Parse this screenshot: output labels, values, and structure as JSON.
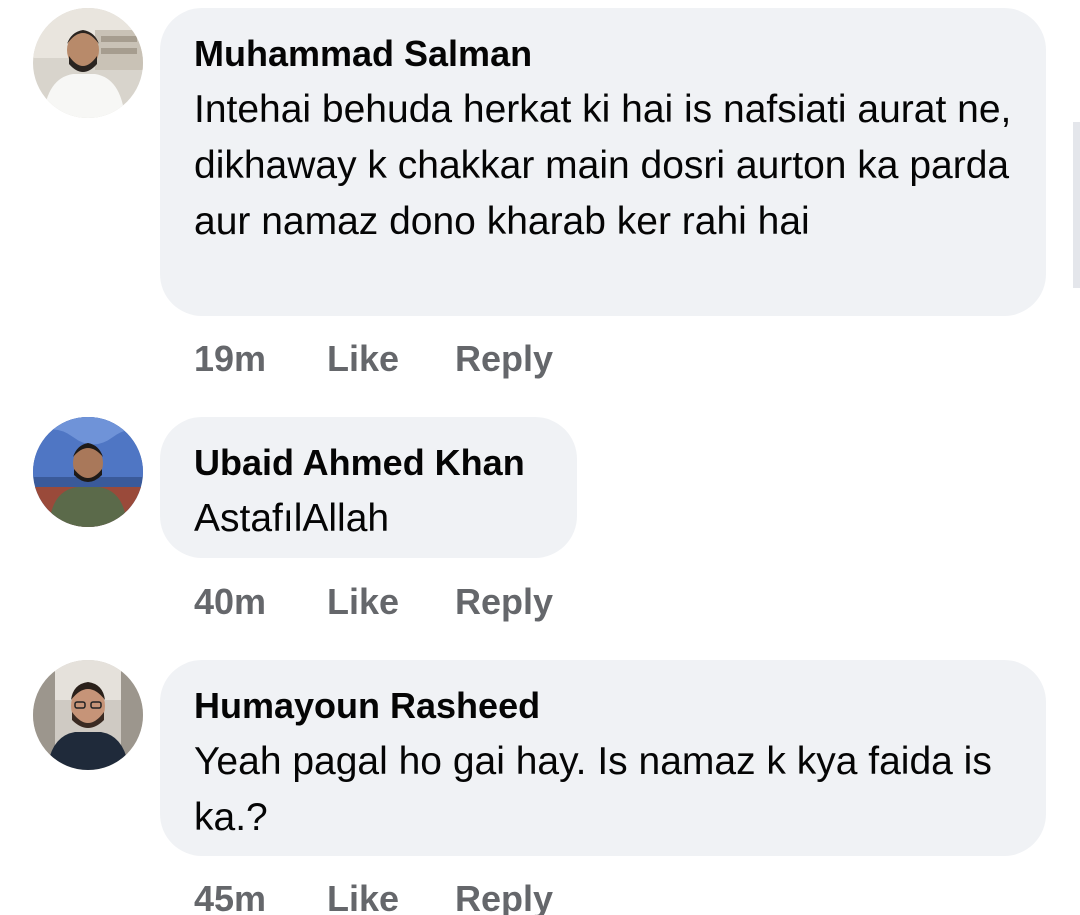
{
  "comments": [
    {
      "author": "Muhammad Salman",
      "text": "Intehai behuda herkat ki hai is nafsiati aurat ne, dikhaway k chakkar main dosri aurton ka parda aur namaz dono kharab ker rahi hai",
      "time": "19m",
      "like_label": "Like",
      "reply_label": "Reply",
      "avatar_icon": "user-avatar-photo"
    },
    {
      "author": "Ubaid Ahmed Khan",
      "text": "AstafılAllah",
      "time": "40m",
      "like_label": "Like",
      "reply_label": "Reply",
      "avatar_icon": "user-avatar-photo"
    },
    {
      "author": "Humayoun Rasheed",
      "text": "Yeah pagal ho gai hay. Is namaz k kya faida is ka.?",
      "time": "45m",
      "like_label": "Like",
      "reply_label": "Reply",
      "avatar_icon": "user-avatar-photo"
    }
  ],
  "colors": {
    "bubble_bg": "#f0f2f5",
    "text": "#050505",
    "secondary_text": "#65676b"
  }
}
